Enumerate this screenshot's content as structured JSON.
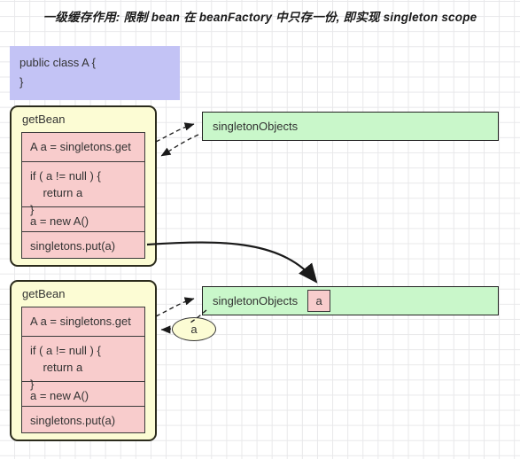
{
  "title": "一级缓存作用: 限制 bean 在 beanFactory 中只存一份, 即实现 singleton scope",
  "class_box": {
    "line1": "public class A {",
    "line2": "}"
  },
  "bean_blocks": [
    {
      "name": "getBean",
      "steps": [
        "A a = singletons.get",
        "if ( a != null ) {\n    return a\n}",
        "a = new A()",
        "singletons.put(a)"
      ]
    },
    {
      "name": "getBean",
      "steps": [
        "A a = singletons.get",
        "if ( a != null ) {\n    return a\n}",
        "a = new A()",
        "singletons.put(a)"
      ]
    }
  ],
  "stores": [
    {
      "label": "singletonObjects",
      "chip": null
    },
    {
      "label": "singletonObjects",
      "chip": "a"
    }
  ],
  "ellipse": {
    "label": "a"
  },
  "colors": {
    "class_box_fill": "#c3c3f5",
    "bean_fill": "#fcfcd4",
    "step_fill": "#f8cccc",
    "store_fill": "#c9f7ca",
    "border": "#2b2b1c",
    "grid": "#e8e8ea"
  }
}
